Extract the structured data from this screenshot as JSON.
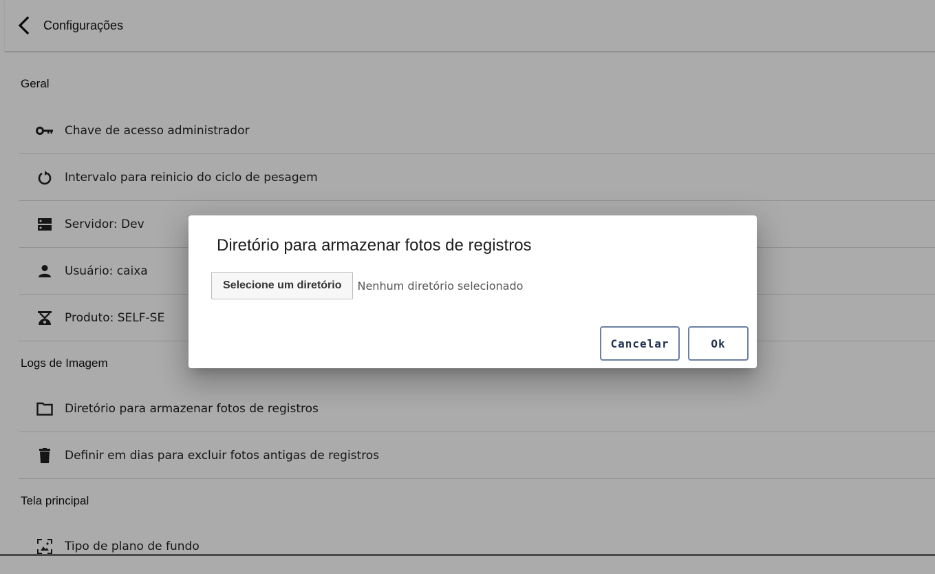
{
  "header": {
    "title": "Configurações"
  },
  "sections": [
    {
      "title": "Geral"
    },
    {
      "title": "Logs de Imagem"
    },
    {
      "title": "Tela principal"
    }
  ],
  "items": {
    "admin_key": {
      "label": "Chave de acesso administrador",
      "icon": "key-icon"
    },
    "restart_interval": {
      "label": "Intervalo para reinicio do ciclo de pesagem",
      "icon": "restart-icon"
    },
    "server": {
      "label": "Servidor: Dev",
      "icon": "server-icon"
    },
    "user": {
      "label": "Usuário: caixa",
      "icon": "person-icon"
    },
    "product": {
      "label": "Produto: SELF-SE",
      "icon": "scale-icon"
    },
    "photo_dir": {
      "label": "Diretório para armazenar fotos de registros",
      "icon": "folder-icon"
    },
    "delete_days": {
      "label": "Definir em dias para excluir fotos antigas de registros",
      "icon": "trash-icon"
    },
    "background": {
      "label": "Tipo de plano de fundo",
      "icon": "wallpaper-icon"
    }
  },
  "dialog": {
    "title": "Diretório para armazenar fotos de registros",
    "file_button": "Selecione um diretório",
    "file_status": "Nenhum diretório selecionado",
    "cancel_label": "Cancelar",
    "ok_label": "Ok"
  },
  "colors": {
    "button_border": "#6a7fa3",
    "button_text": "#22324f",
    "scrim": "rgba(0,0,0,0.33)"
  }
}
